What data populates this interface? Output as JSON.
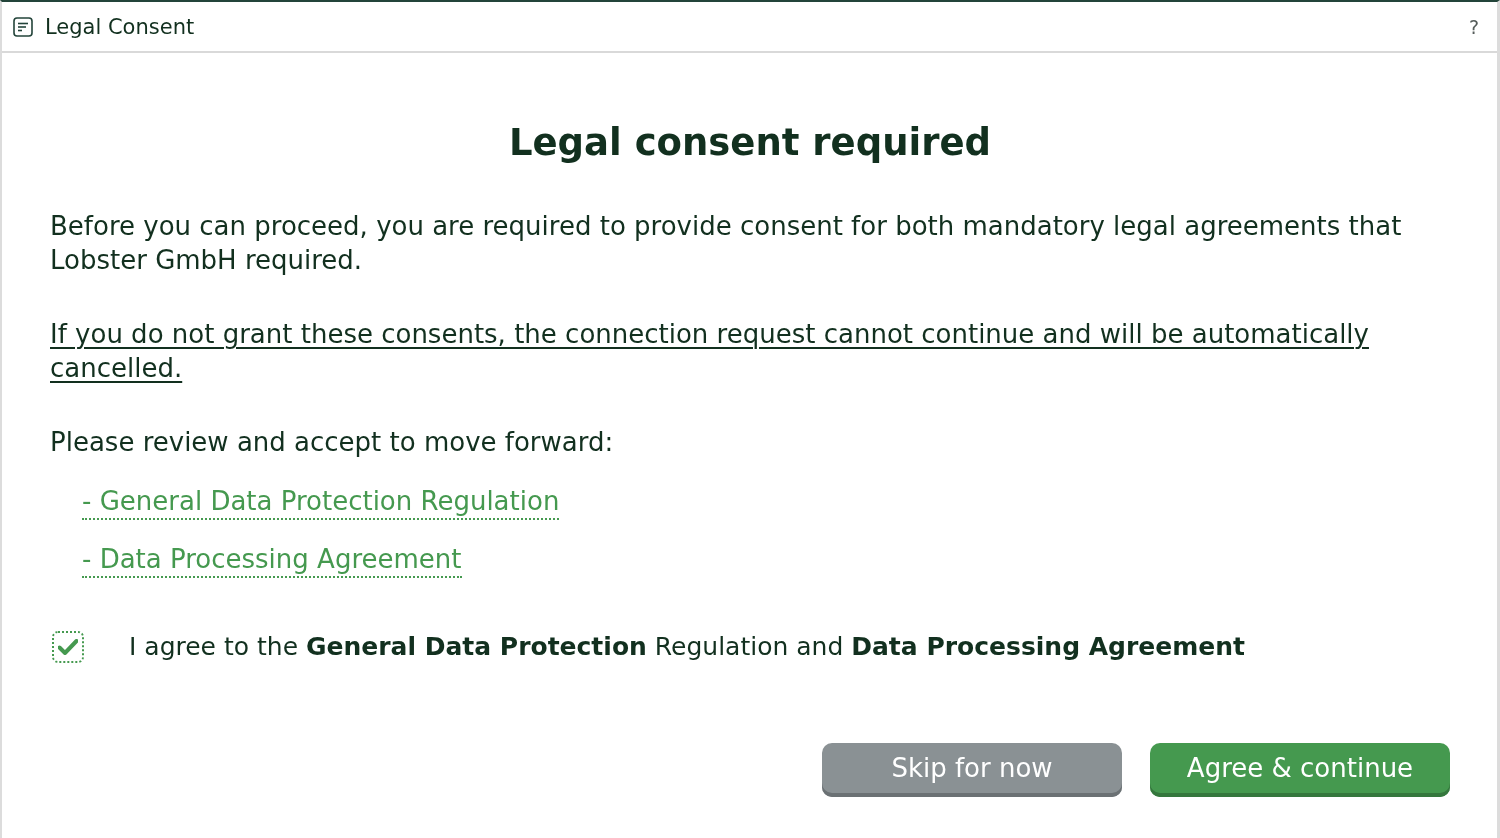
{
  "window": {
    "title": "Legal Consent",
    "help": "?"
  },
  "heading": "Legal consent required",
  "intro": "Before you can proceed, you are required to provide consent for both mandatory legal agreements that Lobster GmbH required.",
  "warning": "If you do not grant these consents, the connection request cannot continue and will be automatically cancelled.",
  "prompt": "Please review and accept to move forward:",
  "documents": [
    {
      "label": "- General Data Protection Regulation"
    },
    {
      "label": "- Data Processing Agreement"
    }
  ],
  "consent": {
    "checked": true,
    "focused": true,
    "label": "I agree to the **General Data Protection** Regulation and **Data Processing Agreement**"
  },
  "buttons": [
    {
      "label": "Skip for now",
      "kind": "secondary"
    },
    {
      "label": "Agree & continue",
      "kind": "primary"
    }
  ]
}
